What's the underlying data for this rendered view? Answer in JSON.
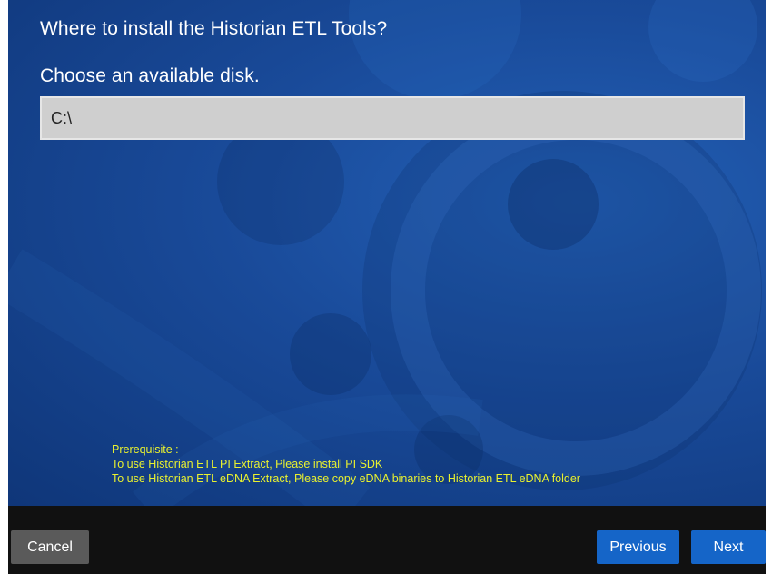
{
  "installer": {
    "title": "Where to install the Historian ETL Tools?",
    "subtitle": "Choose an available disk.",
    "disk_select": {
      "selected_value": "C:\\"
    },
    "prerequisite": {
      "heading": "Prerequisite :",
      "lines": [
        "To use Historian ETL PI Extract, Please install PI SDK",
        "To use Historian ETL eDNA Extract, Please copy eDNA binaries to Historian ETL eDNA folder"
      ]
    }
  },
  "footer": {
    "cancel_label": "Cancel",
    "previous_label": "Previous",
    "next_label": "Next"
  },
  "colors": {
    "panel_blue": "#194a99",
    "footer_black": "#111111",
    "button_blue": "#1565c8",
    "button_gray": "#5a5a5a",
    "prerequisite_yellow": "#e9f12f"
  }
}
